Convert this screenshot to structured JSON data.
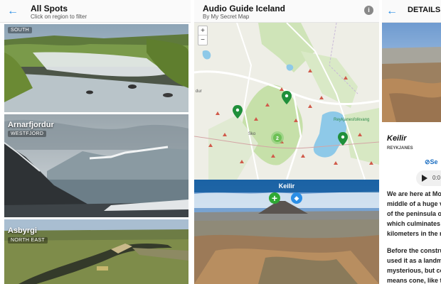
{
  "list_screen": {
    "title": "All Spots",
    "subtitle": "Click on region to filter",
    "cards": [
      {
        "title": "",
        "region": "SOUTH"
      },
      {
        "title": "Arnarfjordur",
        "region": "WESTFJORD"
      },
      {
        "title": "Asbyrgi",
        "region": "NORTH EAST"
      }
    ]
  },
  "map_screen": {
    "title": "Audio Guide Iceland",
    "subtitle": "By My Secret Map",
    "info_icon": "i",
    "zoom_in": "+",
    "zoom_out": "−",
    "cluster_count": "2",
    "map_labels": [
      "Reykjanesfolkvang",
      "Sko",
      "dur"
    ],
    "preview_title": "Keilir",
    "icons": [
      "back-arrow-icon",
      "info-icon",
      "map-pin-icon",
      "add-icon",
      "directions-icon"
    ]
  },
  "details_screen": {
    "title": "DETAILS",
    "place_name": "Keilir",
    "place_region": "REYKJANES",
    "see_label": "Se",
    "audio_time": "0:0",
    "description_lines": [
      "We are here at Mo",
      "middle of a huge v",
      "of the peninsula o",
      "which culminates",
      "kilometers in the r"
    ],
    "description2_lines": [
      "Before the constru",
      "used it as a landm",
      "mysterious, but co",
      "means cone, like t"
    ]
  },
  "colors": {
    "accent_blue": "#2a8ee6",
    "pin_green": "#1f8f3a",
    "add_green": "#2fa834",
    "lake_blue": "#8ec9e8"
  }
}
